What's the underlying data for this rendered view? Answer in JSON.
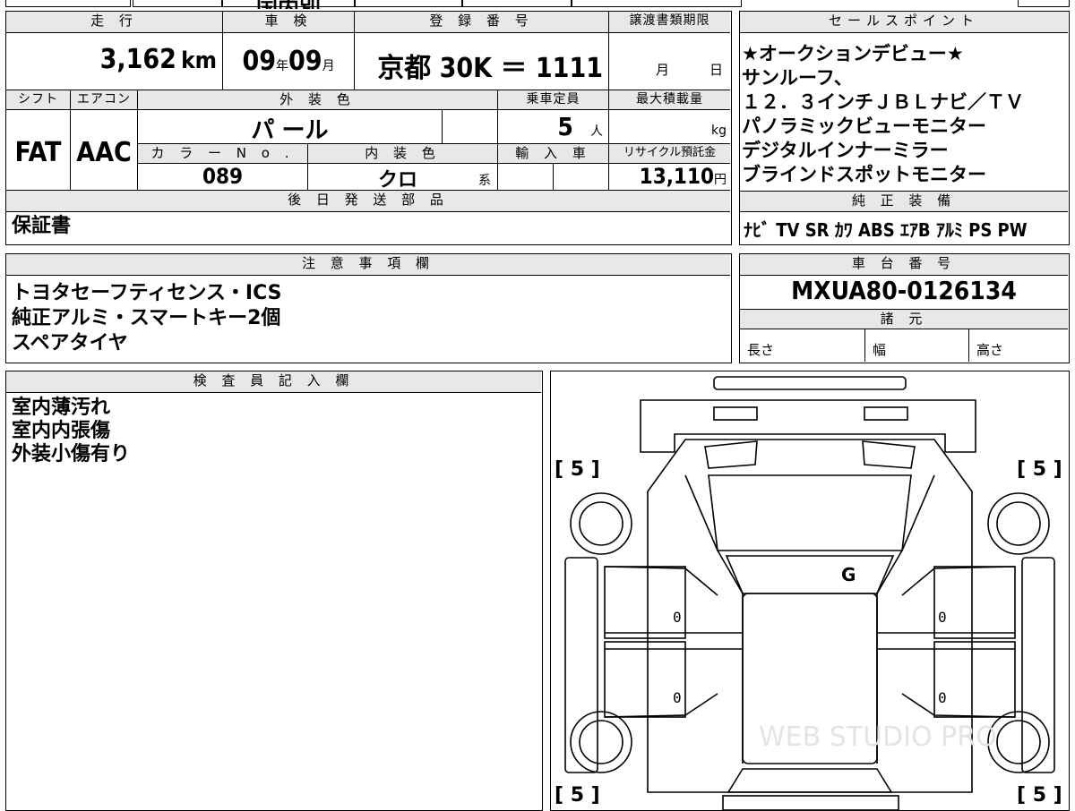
{
  "top_cut": {
    "label": "国内別"
  },
  "headers": {
    "mileage": "走 行",
    "inspection": "車 検",
    "registration": "登 録 番 号",
    "transfer_deadline": "譲渡書類期限",
    "sales_points": "セールスポイント",
    "shift": "シフト",
    "aircon": "エアコン",
    "exterior_color": "外 装 色",
    "capacity": "乗車定員",
    "max_load": "最大積載量",
    "color_no": "カ ラ ー N o .",
    "interior_color": "内 装 色",
    "import": "輸 入 車",
    "recycle": "リサイクル預託金",
    "later_parts": "後 日 発 送 部 品",
    "genuine_equipment": "純 正 装 備",
    "notes": "注 意 事 項 欄",
    "chassis_no": "車 台 番 号",
    "specs": "諸 元",
    "inspector": "検 査 員 記 入 欄"
  },
  "values": {
    "mileage": "3,162",
    "mileage_unit": "km",
    "inspection_year": "09",
    "year_unit": "年",
    "inspection_month": "09",
    "month_unit": "月",
    "registration": "京都 30K ＝ 1111",
    "deadline_month": "月",
    "deadline_day": "日",
    "shift": "FAT",
    "aircon": "AAC",
    "exterior_color": "パ ール",
    "capacity": "5",
    "capacity_unit": "人",
    "max_load_unit": "kg",
    "color_no": "089",
    "interior_color": "クロ",
    "interior_suffix": "系",
    "recycle": "13,110",
    "recycle_unit": "円",
    "later_parts": "保証書",
    "equipment": "ﾅﾋﾞ TV SR ｶﾜ ABS ｴｱB ｱﾙﾐ PS PW",
    "chassis_no": "MXUA80-0126134",
    "spec_length": "長さ",
    "spec_width": "幅",
    "spec_height": "高さ"
  },
  "sales_points": [
    "★オークションデビュー★",
    "サンルーフ、",
    "１２．３インチＪＢＬナビ／ＴＶ",
    "パノラミックビューモニター",
    "デジタルインナーミラー",
    "ブラインドスポットモニター"
  ],
  "notes": [
    "トヨタセーフティセンス・ICS",
    "純正アルミ・スマートキー2個",
    "スペアタイヤ"
  ],
  "inspector_notes": [
    "室内薄汚れ",
    "室内内張傷",
    "外装小傷有り"
  ],
  "diagram": {
    "tire_tl": "[ 5 ]",
    "tire_tr": "[ 5 ]",
    "tire_bl": "[ 5 ]",
    "tire_br": "[ 5 ]",
    "roof_mark": "G",
    "door_fl": "0",
    "door_rl": "0",
    "door_fr": "0",
    "door_rr": "0",
    "watermark": "WEB STUDIO PRO"
  }
}
